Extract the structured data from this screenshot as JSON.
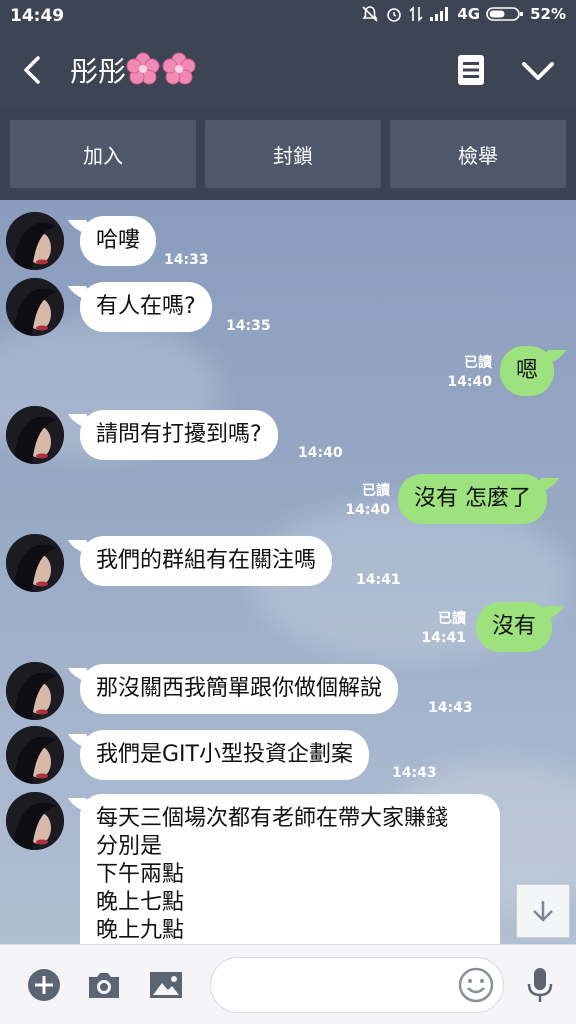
{
  "status_bar": {
    "time": "14:49",
    "network": "4G",
    "battery": "52%"
  },
  "header": {
    "title": "彤彤",
    "icons": [
      "back-arrow-icon",
      "flower-icon",
      "note-icon",
      "chevron-down-icon"
    ]
  },
  "actions": [
    {
      "label": "加入"
    },
    {
      "label": "封鎖"
    },
    {
      "label": "檢舉"
    }
  ],
  "messages": [
    {
      "from": "them",
      "text": "哈嘍",
      "time": "14:33"
    },
    {
      "from": "them",
      "text": "有人在嗎?",
      "time": "14:35"
    },
    {
      "from": "me",
      "text": "嗯",
      "read": "已讀",
      "time": "14:40"
    },
    {
      "from": "them",
      "text": "請問有打擾到嗎?",
      "time": "14:40"
    },
    {
      "from": "me",
      "text": "沒有 怎麼了",
      "read": "已讀",
      "time": "14:40"
    },
    {
      "from": "them",
      "text": "我們的群組有在關注嗎",
      "time": "14:41"
    },
    {
      "from": "me",
      "text": "沒有",
      "read": "已讀",
      "time": "14:41"
    },
    {
      "from": "them",
      "text": "那沒關西我簡單跟你做個解說",
      "time": "14:43"
    },
    {
      "from": "them",
      "text": "我們是GIT小型投資企劃案",
      "time": "14:43"
    },
    {
      "from": "them",
      "lines": [
        "每天三個場次都有老師在帶大家賺錢",
        "分別是",
        "下午兩點",
        "晚上七點",
        "晚上九點"
      ]
    }
  ],
  "colors": {
    "header_bg": "#3d4453",
    "sent_bubble": "#9de27e",
    "received_bubble": "#ffffff",
    "action_button": "#4f586b"
  },
  "input_bar": {
    "placeholder": "",
    "icons": [
      "plus-icon",
      "camera-icon",
      "image-icon",
      "emoji-icon",
      "microphone-icon"
    ]
  }
}
